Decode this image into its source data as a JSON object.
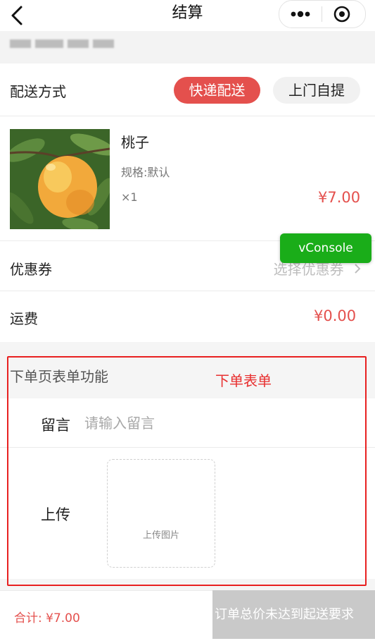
{
  "navbar": {
    "title": "结算",
    "back_icon": "chevron-left-icon",
    "more_icon": "more-dots-icon",
    "target_icon": "target-circle-icon"
  },
  "delivery": {
    "label": "配送方式",
    "options": [
      "快递配送",
      "上门自提"
    ],
    "selected": "快递配送"
  },
  "product": {
    "name": "桃子",
    "spec": "规格:默认",
    "quantity": "×1",
    "price": "¥7.00"
  },
  "coupon": {
    "label": "优惠券",
    "link_text": "选择优惠券"
  },
  "shipping": {
    "label": "运费",
    "value": "¥0.00"
  },
  "vconsole": {
    "label": "vConsole"
  },
  "form": {
    "heading": "下单页表单功能",
    "annotation": "下单表单",
    "message_label": "留言",
    "message_placeholder": "请输入留言",
    "message_value": "",
    "upload_label": "上传",
    "upload_hint": "上传图片"
  },
  "footer": {
    "total": "合计: ¥7.00",
    "submit_label": "订单总价未达到起送要求"
  },
  "colors": {
    "accent": "#e4504d",
    "annotation_red": "#e82020",
    "vconsole_green": "#1aad19",
    "disabled_gray": "#c9c9c9"
  }
}
